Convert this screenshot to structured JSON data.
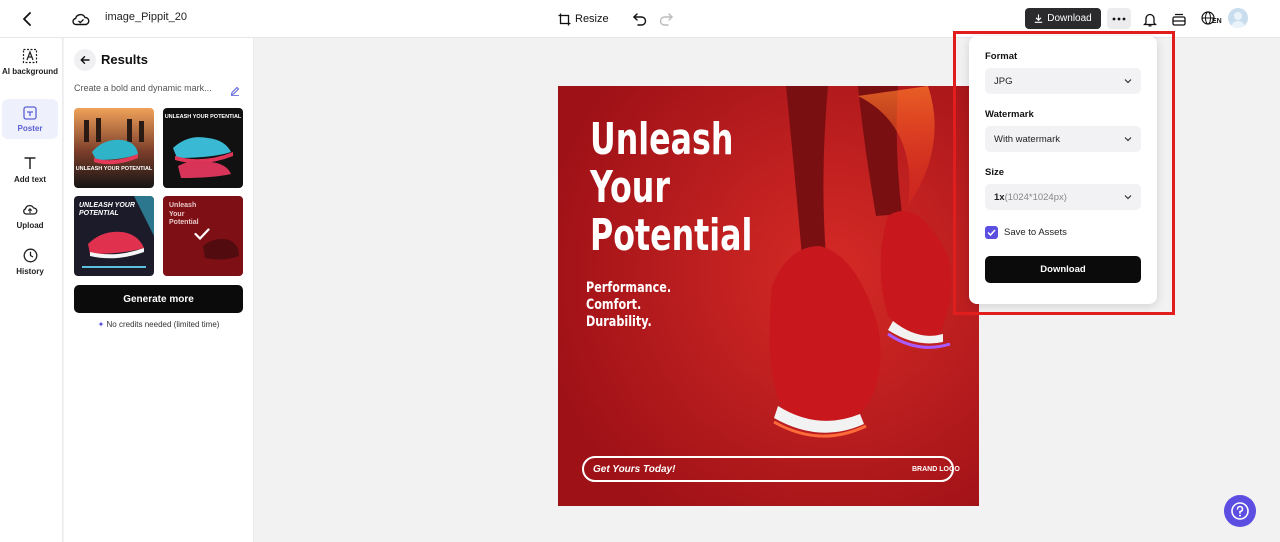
{
  "header": {
    "filename": "image_Pippit_20",
    "resize_label": "Resize",
    "download_label": "Download",
    "language_badge": "EN"
  },
  "rail": {
    "items": [
      {
        "label": "AI background",
        "icon": "ai-background-icon"
      },
      {
        "label": "Poster",
        "icon": "poster-icon",
        "active": true
      },
      {
        "label": "Add text",
        "icon": "text-icon"
      },
      {
        "label": "Upload",
        "icon": "upload-icon"
      },
      {
        "label": "History",
        "icon": "history-icon"
      }
    ]
  },
  "panel": {
    "title": "Results",
    "prompt": "Create a bold and dynamic mark...",
    "thumbnails": [
      {
        "caption": "UNLEASH YOUR POTENTIAL"
      },
      {
        "caption": "UNLEASH YOUR POTENTIAL"
      },
      {
        "caption": "UNLEASH YOUR POTENTIAL"
      },
      {
        "caption": "Unleash Your Potential",
        "selected": true
      }
    ],
    "generate_label": "Generate more",
    "credits_note": "No credits needed (limited time)"
  },
  "poster": {
    "headline_lines": [
      "Unleash",
      "Your",
      "Potential"
    ],
    "tagline_lines": [
      "Performance.",
      "Comfort.",
      "Durability."
    ],
    "cta": "Get Yours Today!",
    "brand": "BRAND LOGO"
  },
  "download_menu": {
    "format_label": "Format",
    "format_value": "JPG",
    "watermark_label": "Watermark",
    "watermark_value": "With watermark",
    "size_label": "Size",
    "size_multiplier": "1x",
    "size_dims": "(1024*1024px)",
    "save_assets_label": "Save to Assets",
    "save_assets_checked": true,
    "download_button": "Download"
  },
  "colors": {
    "accent": "#5b4ee0",
    "poster_red": "#b3141c",
    "highlight": "#e11d1d"
  }
}
